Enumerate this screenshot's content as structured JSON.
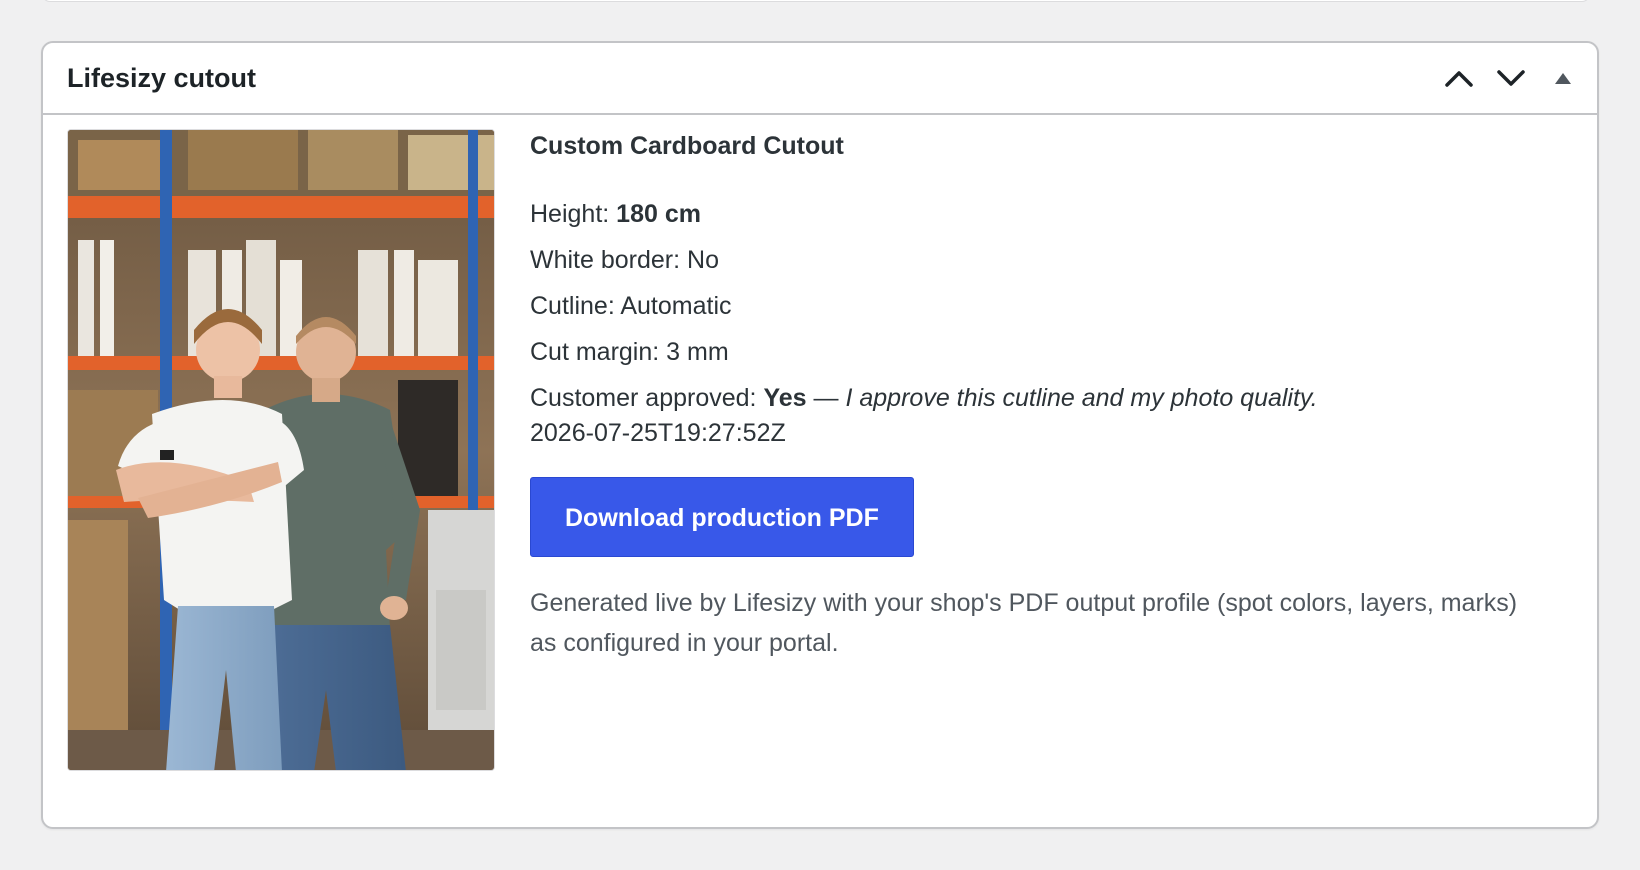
{
  "panel": {
    "title": "Lifesizy cutout",
    "controls": {
      "move_up": "move-up",
      "move_down": "move-down",
      "toggle": "collapse"
    }
  },
  "product": {
    "name": "Custom Cardboard Cutout",
    "photo_description": "photo",
    "meta": {
      "height_label": "Height:",
      "height_value": "180 cm",
      "white_border_label": "White border:",
      "white_border_value": "No",
      "cutline_label": "Cutline:",
      "cutline_value": "Automatic",
      "cut_margin_label": "Cut margin:",
      "cut_margin_value": "3 mm",
      "approved_label": "Customer approved:",
      "approved_value": "Yes",
      "approved_dash": "—",
      "approved_statement": "I approve this cutline and my photo quality.",
      "approved_timestamp": "2026-07-25T19:27:52Z"
    }
  },
  "actions": {
    "download_label": "Download production PDF"
  },
  "note": "Generated live by Lifesizy with your shop's PDF output profile (spot colors, layers, marks) as configured in your portal.",
  "colors": {
    "accent": "#3858e9",
    "background": "#f0f0f1",
    "border": "#c3c4c7",
    "text": "#2c3338",
    "muted": "#50575e"
  }
}
